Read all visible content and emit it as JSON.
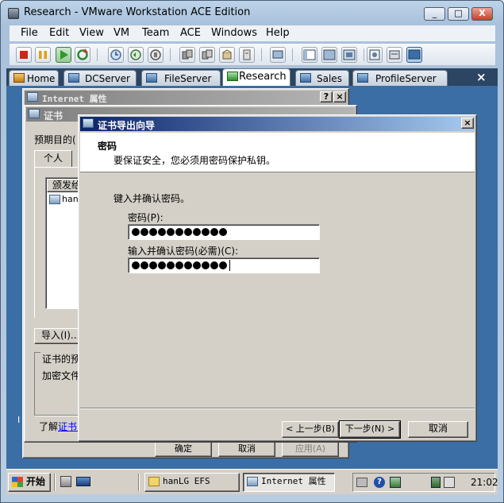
{
  "host": {
    "title": "Research - VMware Workstation ACE Edition",
    "caption_buttons": {
      "minimize": "_",
      "maximize": "□",
      "close": "X"
    },
    "menu": [
      "File",
      "Edit",
      "View",
      "VM",
      "Team",
      "ACE",
      "Windows",
      "Help"
    ],
    "tabs": [
      {
        "label": "Home"
      },
      {
        "label": "DCServer"
      },
      {
        "label": "FileServer"
      },
      {
        "label": "Research"
      },
      {
        "label": "Sales"
      },
      {
        "label": "ProfileServer"
      }
    ],
    "active_tab": "Research",
    "tab_close": "×"
  },
  "guest": {
    "internet_props": {
      "title": "Internet 属性",
      "help_btn": "?",
      "close_btn": "×",
      "ok": "确定",
      "cancel": "取消",
      "apply": "应用(A)"
    },
    "cert_dialog": {
      "title": "证书",
      "purpose_label": "预期目的(",
      "tab_personal": "个人",
      "col_issued_to": "颁发给",
      "row_item": "han",
      "import_btn": "导入(I)...",
      "purpose_group": "证书的预",
      "purpose_value": "加密文件",
      "learn_more_prefix": "了解",
      "learn_more_link": "证书的",
      "left_edge": "I"
    },
    "wizard": {
      "title": "证书导出向导",
      "close_btn": "×",
      "header_title": "密码",
      "header_desc": "要保证安全，您必须用密码保护私钥。",
      "instruction": "键入并确认密码。",
      "password_label": "密码(P):",
      "password_dots": 11,
      "confirm_label": "输入并确认密码(必需)(C):",
      "confirm_dots": 11,
      "back_btn": "< 上一步(B)",
      "next_btn": "下一步(N) >",
      "cancel_btn": "取消"
    },
    "taskbar": {
      "start": "开始",
      "tasks": [
        "hanLG EFS",
        "Internet 属性"
      ],
      "clock": "21:02"
    }
  }
}
